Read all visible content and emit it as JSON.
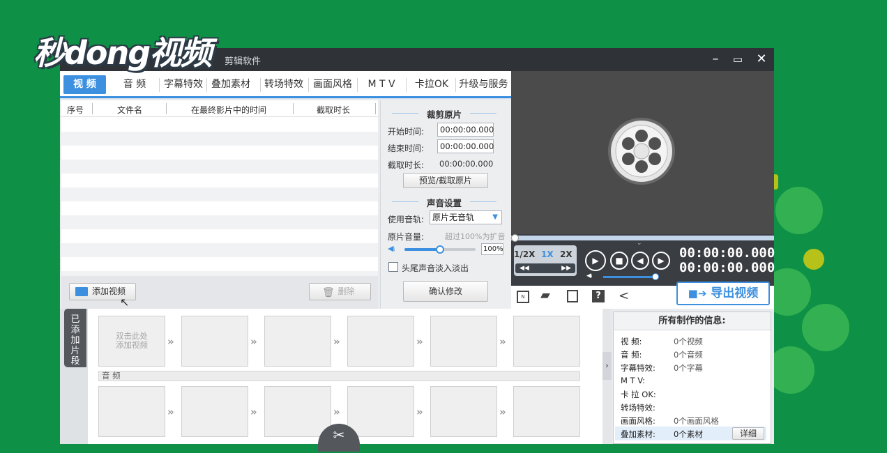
{
  "watermark": {
    "logo_text": "秒dong视频"
  },
  "window": {
    "title_suffix": "剪辑软件",
    "minimize": "–",
    "maximize": "▭",
    "close": "✕"
  },
  "tabs": [
    {
      "label": "视 频",
      "active": true
    },
    {
      "label": "音 频"
    },
    {
      "label": "字幕特效"
    },
    {
      "label": "叠加素材"
    },
    {
      "label": "转场特效"
    },
    {
      "label": "画面风格"
    },
    {
      "label": "M T V"
    },
    {
      "label": "卡拉OK"
    },
    {
      "label": "升级与服务"
    }
  ],
  "file_table": {
    "columns": [
      "序号",
      "文件名",
      "在最终影片中的时间",
      "截取时长"
    ],
    "rows": []
  },
  "left_actions": {
    "add_video": "添加视频",
    "delete": "删除"
  },
  "clip_panel": {
    "title": "裁剪原片",
    "start_label": "开始时间:",
    "start_value": "00:00:00.000",
    "end_label": "结束时间:",
    "end_value": "00:00:00.000",
    "duration_label": "截取时长:",
    "duration_value": "00:00:00.000",
    "preview_button": "预览/截取原片"
  },
  "sound_panel": {
    "title": "声音设置",
    "track_label": "使用音轨:",
    "track_value": "原片无音轨",
    "volume_label": "原片音量:",
    "volume_hint": "超过100%为扩音",
    "volume_percent": "100%",
    "volume_level": 0.5,
    "fade_label": "头尾声音淡入淡出",
    "fade_checked": false,
    "confirm_button": "确认修改"
  },
  "player": {
    "speeds": [
      "1/2X",
      "1X",
      "2X"
    ],
    "active_speed": "1X",
    "time_current": "00:00:00.000",
    "time_total": "00:00:00.000",
    "progress": 0,
    "volume_level": 1.0
  },
  "export_button": "导出视频",
  "timeline": {
    "side_tab": [
      "已",
      "添",
      "加",
      "片",
      "段"
    ],
    "first_slot_text": [
      "双击此处",
      "添加视频"
    ],
    "audio_label": "音 频",
    "slot_count": 6
  },
  "info_panel": {
    "title": "所有制作的信息:",
    "rows": [
      {
        "label": "视    频:",
        "value": "0个视频"
      },
      {
        "label": "音    频:",
        "value": "0个音频"
      },
      {
        "label": "字幕特效:",
        "value": "0个字幕"
      },
      {
        "label": "M  T  V:",
        "value": ""
      },
      {
        "label": "卡 拉 OK:",
        "value": ""
      },
      {
        "label": "转场特效:",
        "value": ""
      },
      {
        "label": "画面风格:",
        "value": "0个画面风格"
      },
      {
        "label": "叠加素材:",
        "value": "0个素材"
      }
    ],
    "detail_button": "详细"
  },
  "colors": {
    "accent": "#3d90df",
    "background": "#0e9146",
    "titlebar": "#2f3338"
  }
}
